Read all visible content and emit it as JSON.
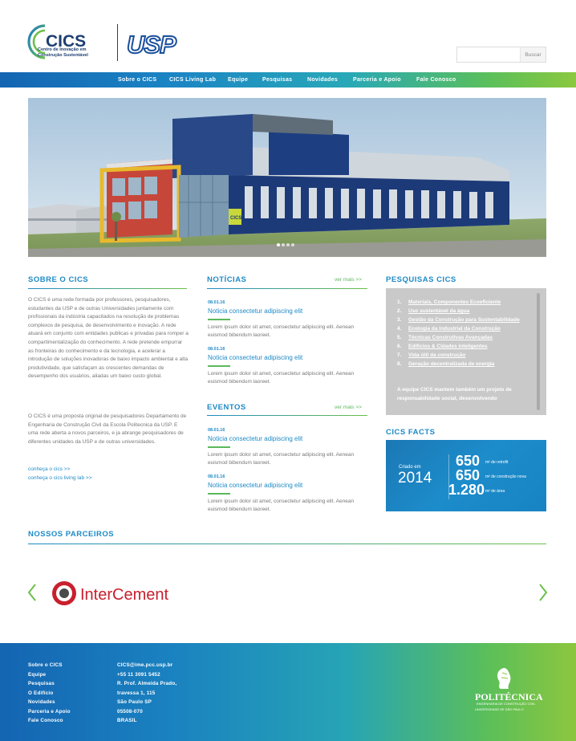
{
  "header": {
    "logo_text": "CICS",
    "logo_tagline": "Centro de Inovação em\nConstrução Sustentável",
    "usp_logo_text": "USP",
    "search": {
      "placeholder": "",
      "button_label": "Buscar"
    }
  },
  "nav": {
    "items": [
      {
        "label": "Sobre o CICS"
      },
      {
        "label": "CICS Living Lab"
      },
      {
        "label": "Equipe"
      },
      {
        "label": "Pesquisas"
      },
      {
        "label": "Novidades"
      },
      {
        "label": "Parceria e Apoio"
      },
      {
        "label": "Fale Conosco"
      }
    ]
  },
  "hero": {
    "slide_count": 4,
    "active_slide": 1,
    "building_sign": "CICS"
  },
  "sobre": {
    "title": "SOBRE O CICS",
    "paragraph1": "O CICS é uma rede formada por professores, pesquisadores, estudantes da USP e de outras Universidades juntamente com profissionais da indústria capacitados na resolução de problemas complexos de pesquisa, de desenvolvimento e inovação. A rede atuará em conjunto com entidades publicas e privadas para romper a compartimentalização do conhecimento. A rede pretende empurrar as fronteiras do conhecimento e da tecnologia, e acelerar a introdução de soluções inovadoras de baixo impacto ambiental e alta produtividade, que satisfaçam as crescentes demandas de desempenho dos usuários, aliadas um baixo custo global.",
    "paragraph2": "O CICS é uma proposta original de pesquisadores Departamento de Engenharia de Construção Civil da Escola Politecnica da USP. E uma rede aberta a novos parceiros, e ja abrange pesquisadores de diferentes unidades da USP e de outras universidades.",
    "link1": "conheça o cics >>",
    "link2": "conheça o cics living lab >>"
  },
  "noticias": {
    "title": "NOTÍCIAS",
    "more": "ver mais >>",
    "items": [
      {
        "date": "08.01.16",
        "title": "Noticia consectetur adipiscing elit",
        "body": "Lorem ipsum dolor sit amet, consectetur adipiscing elit. Aenean euismod bibendum laoreet."
      },
      {
        "date": "08.01.16",
        "title": "Noticia consectetur adipiscing elit",
        "body": "Lorem ipsum dolor sit amet, consectetur adipiscing elit. Aenean euismod bibendum laoreet."
      }
    ]
  },
  "eventos": {
    "title": "EVENTOS",
    "more": "ver mais >>",
    "items": [
      {
        "date": "08.01.16",
        "title": "Noticia consectetur adipiscing elit",
        "body": "Lorem ipsum dolor sit amet, consectetur adipiscing elit. Aenean euismod bibendum laoreet."
      },
      {
        "date": "08.01.16",
        "title": "Noticia consectetur adipiscing elit",
        "body": "Lorem ipsum dolor sit amet, consectetur adipiscing elit. Aenean euismod bibendum laoreet."
      }
    ]
  },
  "pesquisas": {
    "title": "PESQUISAS CICS",
    "items": [
      {
        "num": "1.",
        "label": "Materiais, Componentes Ecoeficiente"
      },
      {
        "num": "2.",
        "label": "Uso sustentável da água"
      },
      {
        "num": "3.",
        "label": "Gestão da Construção para Sustentabilidade"
      },
      {
        "num": "4.",
        "label": "Ecologia da Industrial da Construção"
      },
      {
        "num": "5.",
        "label": "Técnicas Construtivas Avançadas"
      },
      {
        "num": "6.",
        "label": "Edifícios & Cidades inteligentes"
      },
      {
        "num": "7.",
        "label": "Vida útil da construção"
      },
      {
        "num": "8.",
        "label": "Geração decentralizada de energia"
      }
    ],
    "text": "A equipe CICS mantem também um projeto de responsabilidade social, desenvolvendo"
  },
  "facts": {
    "title": "CICS FACTS",
    "created_label": "Criado em",
    "created_year": "2014",
    "stat1_value": "650",
    "stat1_label": "m² de retrofit",
    "stat2_value": "650",
    "stat2_label": "m² de construção nova",
    "stat3_value": "1.280",
    "stat3_label": "m² de área"
  },
  "parceiros": {
    "title": "NOSSOS PARCEIROS",
    "partner_name": "InterCement"
  },
  "footer": {
    "links": [
      "Sobre o CICS",
      "Equipe",
      "Pesquisas",
      "O Edifício",
      "Novidades",
      "Parceria e Apoio",
      "Fale Conosco"
    ],
    "contact": [
      "CICS@ime.pcc.usp.br",
      "+55 11 3091 5452",
      "R. Prof. Almeida Prado,",
      "travessa 1, 115",
      "São Paulo SP",
      "05508-070",
      "BRASIL"
    ],
    "poli_name": "POLITÉCNICA",
    "poli_sub1": "ENGENHARIA DE CONSTRUÇÃO CIVIL",
    "poli_sub2": "UNIVERSIDADE DE SÃO PAULO"
  },
  "colors": {
    "primary_blue": "#1e8ac6",
    "accent_green": "#5cb85c",
    "nav_gradient_start": "#1465b2",
    "nav_gradient_end": "#8bc83f"
  }
}
